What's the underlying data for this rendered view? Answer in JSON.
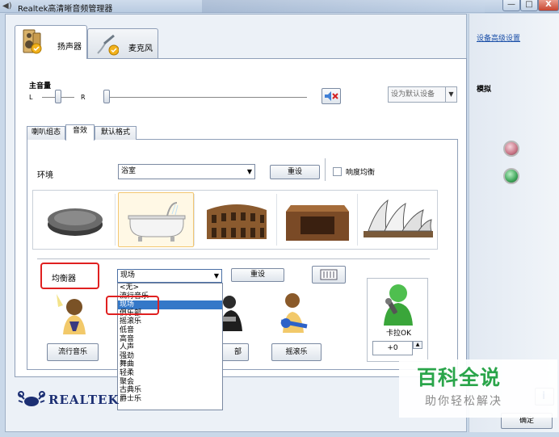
{
  "window": {
    "title": "Realtek高清晰音频管理器",
    "controls": {
      "minimize": "—",
      "maximize": "□",
      "close": "X"
    }
  },
  "right_panel": {
    "advanced_link": "设备高级设置",
    "analog_label": "模拟",
    "jack_colors": {
      "pink": "#c87586",
      "green": "#3fa55a"
    }
  },
  "device_tabs": [
    {
      "label": "扬声器",
      "icon": "speaker-icon",
      "selected": true
    },
    {
      "label": "麦克风",
      "icon": "microphone-icon",
      "selected": false
    }
  ],
  "volume": {
    "title": "主音量",
    "left_label": "L",
    "right_label": "R",
    "mute_icon": "speaker-muted-icon",
    "default_device": "设为默认设备",
    "default_device_arrow": "▼"
  },
  "inner_tabs": [
    {
      "label": "喇叭组态",
      "selected": false
    },
    {
      "label": "音效",
      "selected": true
    },
    {
      "label": "默认格式",
      "selected": false
    }
  ],
  "environment": {
    "label": "环境",
    "selected": "浴室",
    "reset_label": "重设",
    "loudness_label": "响度均衡",
    "loudness_checked": false,
    "thumbnails": [
      "stone-disc",
      "bathroom",
      "colosseum",
      "stone-room",
      "opera-house"
    ]
  },
  "equalizer": {
    "label": "均衡器",
    "selected": "现场",
    "reset_label": "重设",
    "options": [
      "<无>",
      "流行音乐",
      "现场",
      "俱乐部",
      "摇滚乐",
      "低音",
      "高音",
      "人声",
      "强劲",
      "舞曲",
      "轻柔",
      "聚会",
      "古典乐",
      "爵士乐"
    ],
    "highlighted": "现场",
    "presets": {
      "pop": "流行音乐",
      "club": "部",
      "rock": "摇滚乐"
    }
  },
  "karaoke": {
    "label": "卡拉OK",
    "value": "+0",
    "spin_up": "▲"
  },
  "bottom": {
    "brand": "REALTEK",
    "ok_label": "确定"
  },
  "watermark": {
    "main": "百科全说",
    "sub": "助你轻松解决"
  },
  "colors": {
    "accent": "#3478c8",
    "annotation_red": "#e02020",
    "watermark_green": "#2aa54a"
  }
}
